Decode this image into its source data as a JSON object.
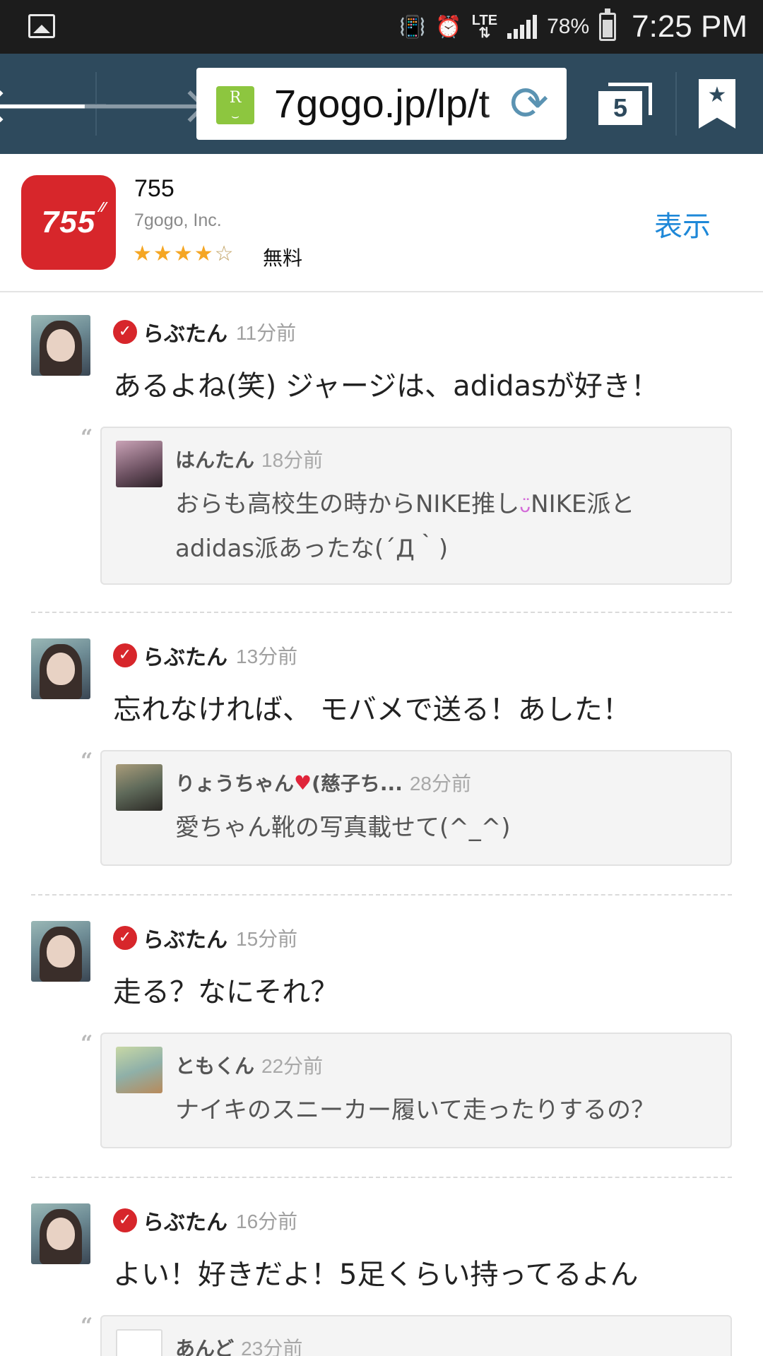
{
  "status_bar": {
    "battery_percent": "78%",
    "time": "7:25 PM",
    "network": "LTE"
  },
  "browser": {
    "url": "7gogo.jp/lp/t",
    "tab_count": "5"
  },
  "app_banner": {
    "name": "755",
    "developer": "7gogo, Inc.",
    "icon_text": "755",
    "rating": 4,
    "rating_max": 5,
    "price": "無料",
    "view_label": "表示",
    "view_color": "#1e88d8",
    "icon_color": "#d7262b"
  },
  "posts": [
    {
      "author": "らぶたん",
      "time": "11分前",
      "text": "あるよね(笑) ジャージは、adidasが好き！",
      "reply": {
        "author": "はんたん",
        "time": "18分前",
        "text_part1": "おらも高校生の時からNIKE推し",
        "emoji": "ᴗ̈",
        "text_part2": "NIKE派と",
        "text_line2": "adidas派あったな(´Д｀)"
      }
    },
    {
      "author": "らぶたん",
      "time": "13分前",
      "text": "忘れなければ、 モバメで送る！あした！",
      "reply": {
        "author": "りょうちゃん",
        "author_suffix": "(慈子ち...",
        "time": "28分前",
        "text": "愛ちゃん靴の写真載せて(^_^)"
      }
    },
    {
      "author": "らぶたん",
      "time": "15分前",
      "text": "走る？なにそれ？",
      "reply": {
        "author": "ともくん",
        "time": "22分前",
        "text": "ナイキのスニーカー履いて走ったりするの？"
      }
    },
    {
      "author": "らぶたん",
      "time": "16分前",
      "text": "よい！好きだよ！5足くらい持ってるよん",
      "reply": {
        "author": "あんど",
        "time": "23分前"
      }
    }
  ]
}
